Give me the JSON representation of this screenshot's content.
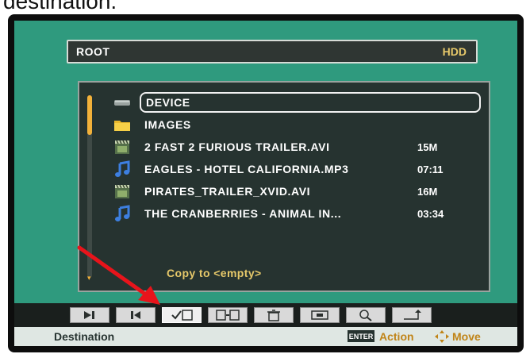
{
  "caption": "destination.",
  "header": {
    "path": "ROOT",
    "drive": "HDD"
  },
  "files": [
    {
      "name": "DEVICE",
      "type": "device",
      "meta": ""
    },
    {
      "name": "IMAGES",
      "type": "folder",
      "meta": ""
    },
    {
      "name": "2 FAST 2 FURIOUS TRAILER.AVI",
      "type": "video",
      "meta": "15M"
    },
    {
      "name": "EAGLES - HOTEL CALIFORNIA.MP3",
      "type": "music",
      "meta": "07:11"
    },
    {
      "name": "PIRATES_TRAILER_XVID.AVI",
      "type": "video",
      "meta": "16M"
    },
    {
      "name": "THE CRANBERRIES - ANIMAL IN...",
      "type": "music",
      "meta": "03:34"
    }
  ],
  "copy_status": "Copy to <empty>",
  "toolbar": {
    "buttons": [
      "play-next-icon",
      "previous-icon",
      "check-copy-icon",
      "copy-icon",
      "delete-icon",
      "window-icon",
      "search-icon",
      "return-icon"
    ],
    "active_index": 2
  },
  "status": {
    "left": "Destination",
    "enter_key": "ENTER",
    "action": "Action",
    "move": "Move"
  },
  "colors": {
    "background": "#2f9a7e",
    "panel": "#263330",
    "accent": "#e7c96a",
    "arrow": "#e8141b"
  }
}
